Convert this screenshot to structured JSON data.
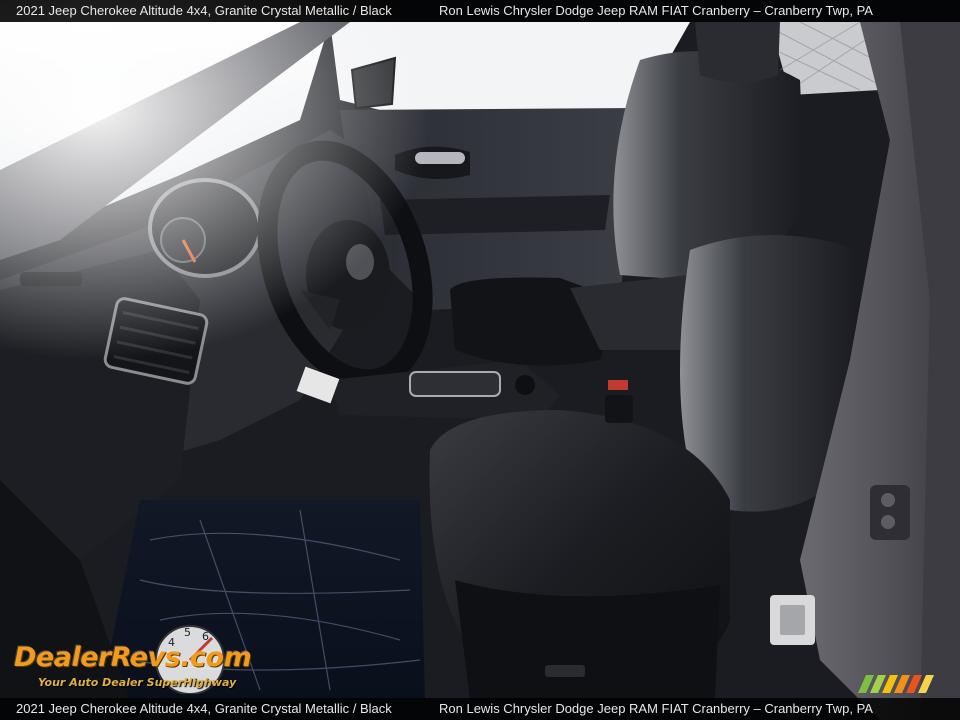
{
  "caption": {
    "vehicle": "2021 Jeep Cherokee Altitude 4x4,  Granite Crystal Metallic / Black",
    "dealer": "Ron Lewis Chrysler Dodge Jeep RAM FIAT Cranberry – Cranberry Twp, PA"
  },
  "watermark": {
    "brand": "DealerRevs.com",
    "tagline": "Your Auto Dealer SuperHighway"
  },
  "colors": {
    "caption_bg": "#000000",
    "caption_text": "#e8e8e8",
    "watermark_orange": "#f29a1c",
    "interior_black": "#16171b",
    "exterior_granite": "#4d4c52"
  }
}
